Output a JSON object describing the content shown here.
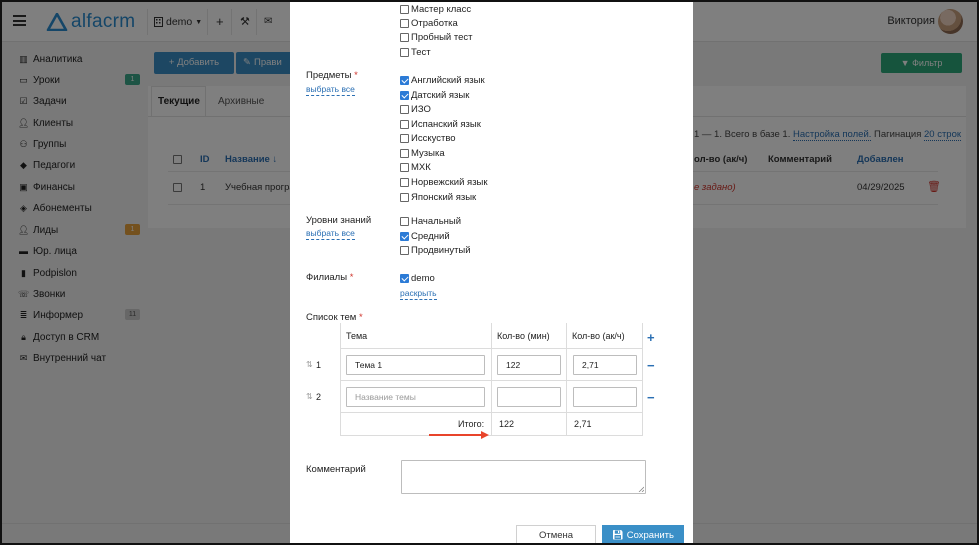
{
  "app": {
    "logo_text": "alfacrm",
    "branch": "demo",
    "user_name": "Виктория"
  },
  "sidebar": {
    "items": [
      {
        "label": "Аналитика",
        "icon": "analytics-icon"
      },
      {
        "label": "Уроки",
        "icon": "calendar-icon",
        "badge": "1"
      },
      {
        "label": "Задачи",
        "icon": "tasks-icon"
      },
      {
        "label": "Клиенты",
        "icon": "user-icon"
      },
      {
        "label": "Группы",
        "icon": "users-icon"
      },
      {
        "label": "Педагоги",
        "icon": "graduation-cap-icon"
      },
      {
        "label": "Финансы",
        "icon": "money-icon"
      },
      {
        "label": "Абонементы",
        "icon": "tag-icon"
      },
      {
        "label": "Лиды",
        "icon": "user-plus-icon",
        "badge": "1"
      },
      {
        "label": "Юр. лица",
        "icon": "briefcase-icon"
      },
      {
        "label": "Podpislon",
        "icon": "document-icon"
      },
      {
        "label": "Звонки",
        "icon": "phone-icon"
      },
      {
        "label": "Информер",
        "icon": "list-icon",
        "badge": "11"
      },
      {
        "label": "Доступ в CRM",
        "icon": "lock-icon"
      },
      {
        "label": "Внутренний чат",
        "icon": "chat-icon"
      }
    ],
    "badge_colors": {
      "lessons": "#3aa88a",
      "leads": "#e8a33d",
      "informer": "#cfcfcf"
    }
  },
  "toolbar": {
    "add_label": "+ Добавить",
    "edit_label": "Прави",
    "filter_label": "Фильтр"
  },
  "tabs": [
    {
      "label": "Текущие"
    },
    {
      "label": "Архивные"
    }
  ],
  "table": {
    "info_prefix": "1 — 1. Всего в базе 1.",
    "settings_link": "Настройка полей.",
    "pagination_label": "Пагинация",
    "pagination_value": "20 строк",
    "headers": {
      "id": "ID",
      "name": "Название ↓",
      "count": "ол-во (ак/ч)",
      "comment": "Комментарий",
      "added": "Добавлен"
    },
    "row": {
      "id": "1",
      "name": "Учебная програ",
      "count": "е задано)",
      "added": "04/29/2025"
    }
  },
  "modal": {
    "types": [
      "Мастер класс",
      "Отработка",
      "Пробный тест",
      "Тест"
    ],
    "subjects_label": "Предметы",
    "select_all": "выбрать все",
    "subjects": [
      {
        "label": "Английский язык",
        "checked": true
      },
      {
        "label": "Датский язык",
        "checked": true
      },
      {
        "label": "ИЗО",
        "checked": false
      },
      {
        "label": "Испанский язык",
        "checked": false
      },
      {
        "label": "Исскуство",
        "checked": false
      },
      {
        "label": "Музыка",
        "checked": false
      },
      {
        "label": "МХК",
        "checked": false
      },
      {
        "label": "Норвежский язык",
        "checked": false
      },
      {
        "label": "Японский язык",
        "checked": false
      }
    ],
    "levels_label": "Уровни знаний",
    "levels": [
      {
        "label": "Начальный",
        "checked": false
      },
      {
        "label": "Средний",
        "checked": true
      },
      {
        "label": "Продвинутый",
        "checked": false
      }
    ],
    "branches_label": "Филиалы",
    "branch_option": {
      "label": "demo",
      "checked": true
    },
    "expand_link": "раскрыть",
    "topics_label": "Список тем",
    "topics_headers": {
      "topic": "Тема",
      "minutes": "Кол-во (мин)",
      "hours": "Кол-во (ак/ч)"
    },
    "topics": [
      {
        "num": "1",
        "name": "Тема 1",
        "minutes": "122",
        "hours": "2,71"
      },
      {
        "num": "2",
        "name": "",
        "placeholder": "Название темы",
        "minutes": "",
        "hours": ""
      }
    ],
    "total_label": "Итого:",
    "total_minutes": "122",
    "total_hours": "2,71",
    "comment_label": "Комментарий",
    "cancel_label": "Отмена",
    "save_label": "Сохранить"
  },
  "colors": {
    "accent": "#3a8fc7",
    "filter": "#2da87a",
    "required": "#d0342c",
    "arrow": "#e8442b",
    "checkbox": "#2c7bd6"
  }
}
